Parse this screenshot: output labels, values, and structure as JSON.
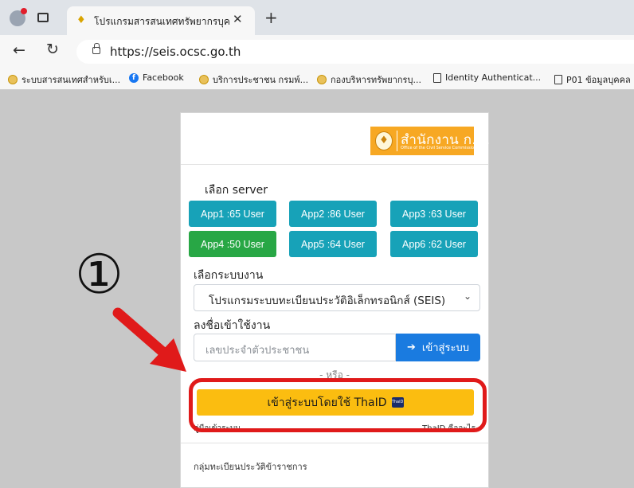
{
  "browser": {
    "tab_title": "โปรแกรมสารสนเทศทรัพยากรบุคคล -",
    "url": "https://seis.ocsc.go.th",
    "bookmarks": [
      "ระบบสารสนเทศสำหรับเ...",
      "Facebook",
      "บริการประชาชน กรมพ์...",
      "กองบริหารทรัพยากรบุ...",
      "Identity Authenticat...",
      "P01 ข้อมูลบุคคล"
    ]
  },
  "page": {
    "logo_text": "สำนักงาน ก.พ.",
    "logo_subtext": "Office of the Civil Service Commission",
    "server_label": "เลือก server",
    "servers": [
      "App1 :65 User",
      "App2 :86 User",
      "App3 :63 User",
      "App4 :50 User",
      "App5 :64 User",
      "App6 :62 User"
    ],
    "selected_server_color": "#28a745",
    "server_color": "#17a2b8",
    "system_label": "เลือกระบบงาน",
    "system_value": "โปรแกรมระบบทะเบียนประวัติอิเล็กทรอนิกส์ (SEIS)",
    "login_label": "ลงชื่อเข้าใช้งาน",
    "id_placeholder": "เลขประจำตัวประชาชน",
    "login_button": "เข้าสู่ระบบ",
    "or_text": "- หรือ -",
    "thaid_button": "เข้าสู่ระบบโดยใช้ ThaID",
    "manual_link": "คู่มือเข้าระบบ",
    "thaid_faq_link": "ThaID คืออะไร",
    "footer_text": "กลุ่มทะเบียนประวัติข้าราชการ"
  },
  "annotation": {
    "step_number": "①",
    "highlight_color": "#e01a1a"
  }
}
